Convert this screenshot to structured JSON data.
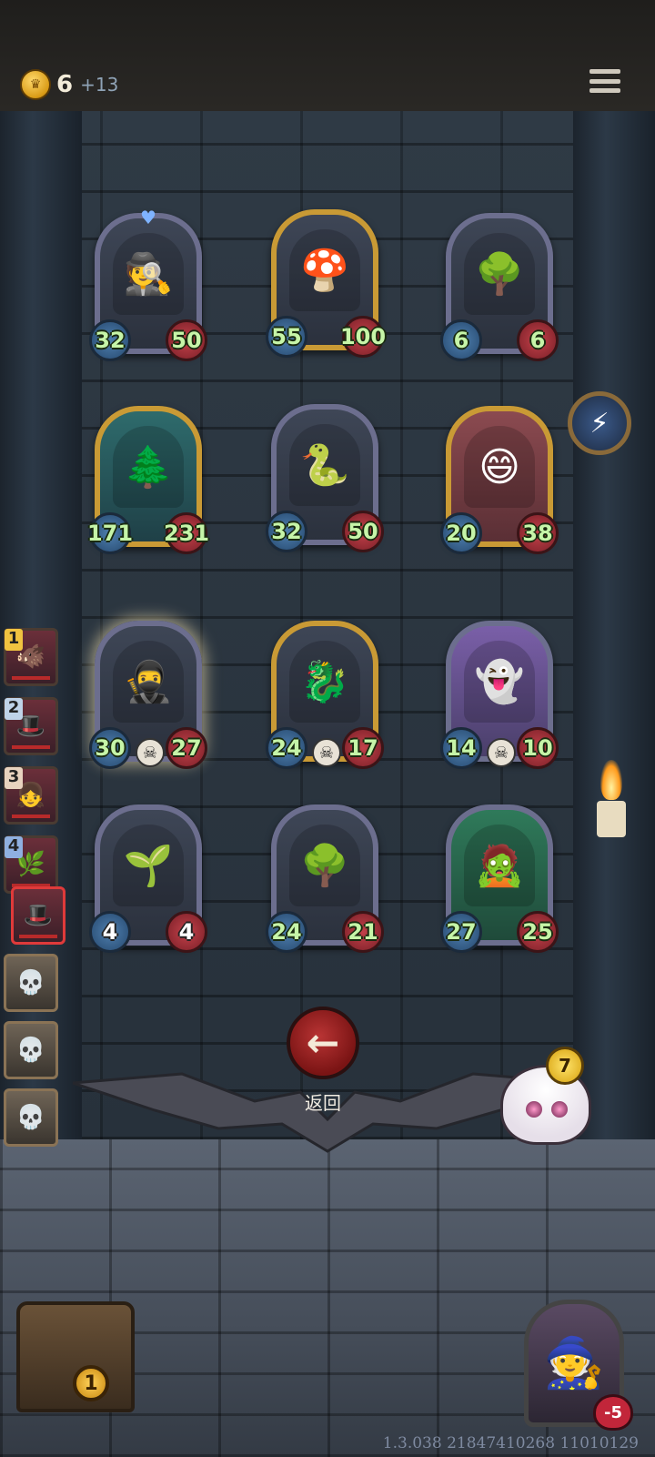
{
  "header": {
    "gold": "6",
    "gold_increment": "+13"
  },
  "board": {
    "cards": [
      {
        "name": "detective",
        "atk": "32",
        "hp": "50",
        "icon": "🕵️"
      },
      {
        "name": "mushroom-spider",
        "atk": "55",
        "hp": "100",
        "icon": "🍄"
      },
      {
        "name": "treant",
        "atk": "6",
        "hp": "6",
        "icon": "🌳"
      },
      {
        "name": "treant-brute",
        "atk": "171",
        "hp": "231",
        "icon": "🌲"
      },
      {
        "name": "serpent",
        "atk": "32",
        "hp": "50",
        "icon": "🐍"
      },
      {
        "name": "red-bean",
        "atk": "20",
        "hp": "38",
        "icon": "😄"
      },
      {
        "name": "hooded-rogue",
        "atk": "30",
        "hp": "27",
        "icon": "🥷"
      },
      {
        "name": "dragonling",
        "atk": "24",
        "hp": "17",
        "icon": "🐉"
      },
      {
        "name": "ghost-maiden",
        "atk": "14",
        "hp": "10",
        "icon": "👻"
      },
      {
        "name": "mandrake",
        "atk": "4",
        "hp": "4",
        "icon": "🌱"
      },
      {
        "name": "treant-elder",
        "atk": "24",
        "hp": "21",
        "icon": "🌳"
      },
      {
        "name": "spirit-pack",
        "atk": "27",
        "hp": "25",
        "icon": "🧟"
      }
    ]
  },
  "queue": {
    "numbers": [
      "1",
      "2",
      "3",
      "4"
    ]
  },
  "back_button": {
    "label": "返回"
  },
  "pet": {
    "badge": "7"
  },
  "chest": {
    "badge": "1"
  },
  "hero": {
    "hp": "-5"
  },
  "footer": {
    "version": "1.3.038 21847410268 11010129"
  }
}
